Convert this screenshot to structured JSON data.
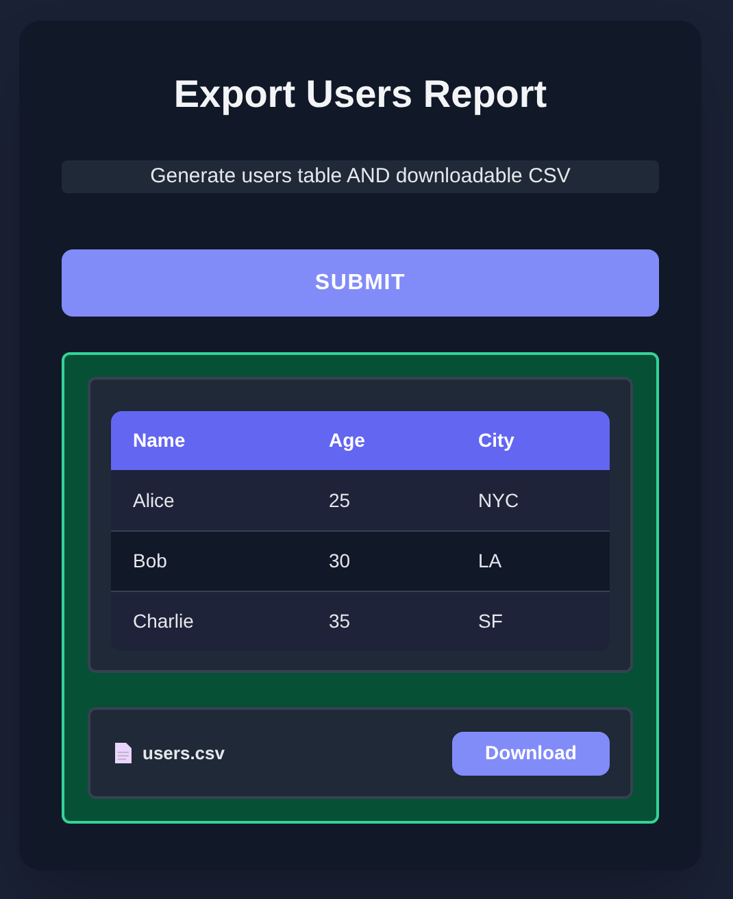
{
  "title": "Export Users Report",
  "description": "Generate users table AND downloadable CSV",
  "submit_button": "SUBMIT",
  "table": {
    "columns": [
      "Name",
      "Age",
      "City"
    ],
    "rows": [
      [
        "Alice",
        "25",
        "NYC"
      ],
      [
        "Bob",
        "30",
        "LA"
      ],
      [
        "Charlie",
        "35",
        "SF"
      ]
    ]
  },
  "file": {
    "name": "users.csv",
    "button": "Download"
  }
}
